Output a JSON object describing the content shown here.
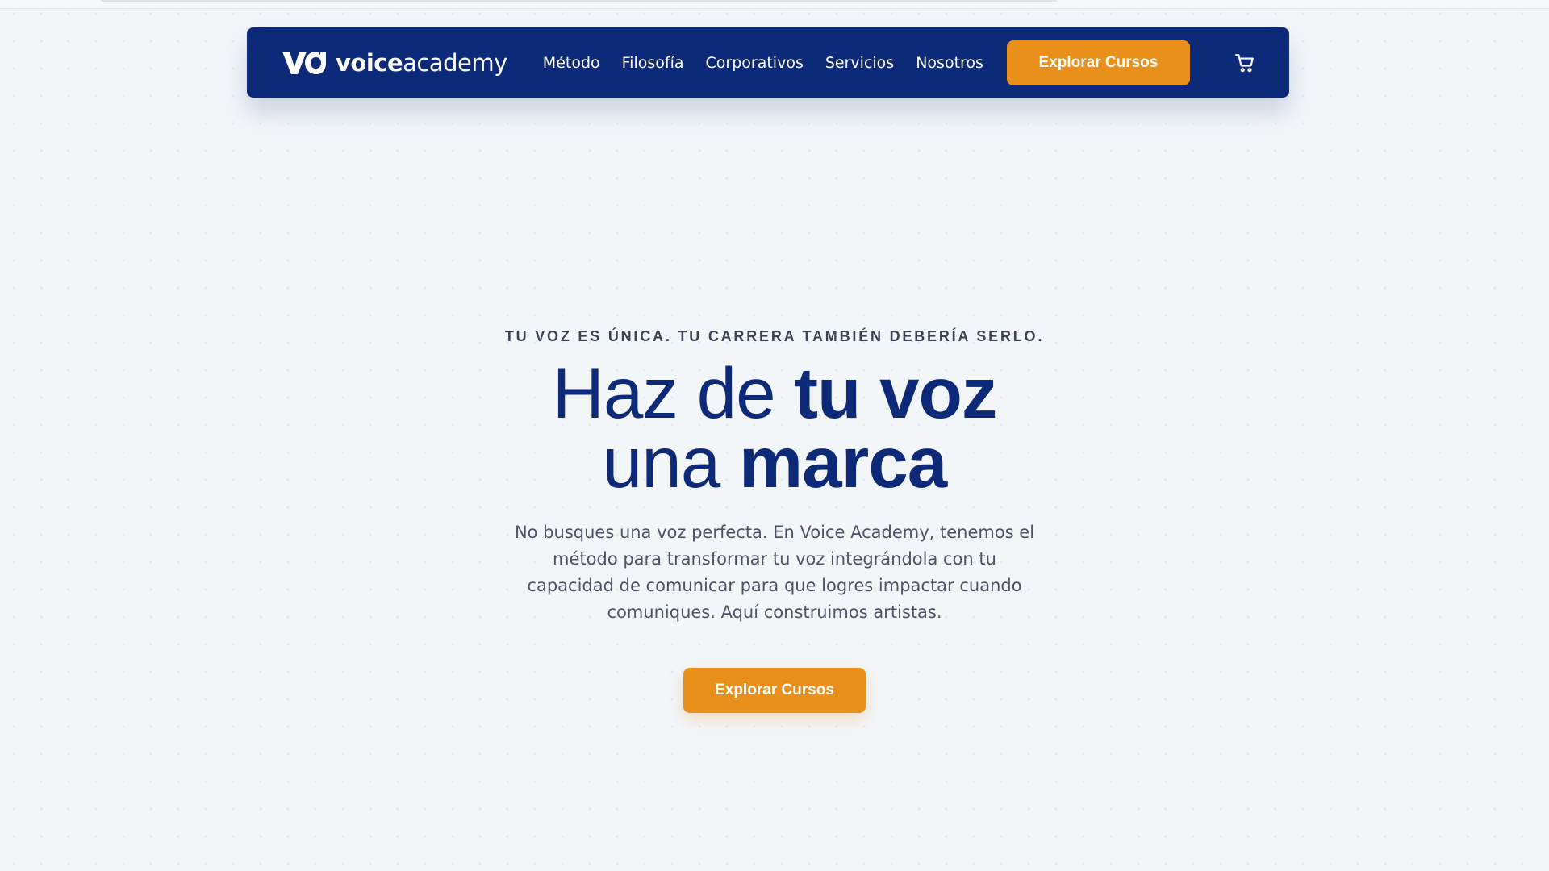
{
  "brand": {
    "name_strong": "voice",
    "name_light": "academy",
    "logo_text": "VA",
    "colors": {
      "navy": "#0c2a78",
      "orange": "#e98f1b",
      "background": "#f3f6f9"
    }
  },
  "nav": {
    "links": [
      "Método",
      "Filosofía",
      "Corporativos",
      "Servicios",
      "Nosotros"
    ],
    "cta_label": "Explorar Cursos",
    "cart_icon": "cart-icon"
  },
  "hero": {
    "eyebrow": "TU VOZ ES ÚNICA. TU CARRERA TAMBIÉN DEBERÍA SERLO.",
    "headline_line1_light": "Haz de ",
    "headline_line1_bold": "tu voz",
    "headline_line2_light": "una ",
    "headline_line2_bold": "marca",
    "description": "No busques una voz perfecta. En Voice Academy, tenemos el método para transformar tu voz integrándola con tu capacidad de comunicar para que logres impactar cuando comuniques. Aquí construimos artistas.",
    "cta_label": "Explorar Cursos"
  }
}
